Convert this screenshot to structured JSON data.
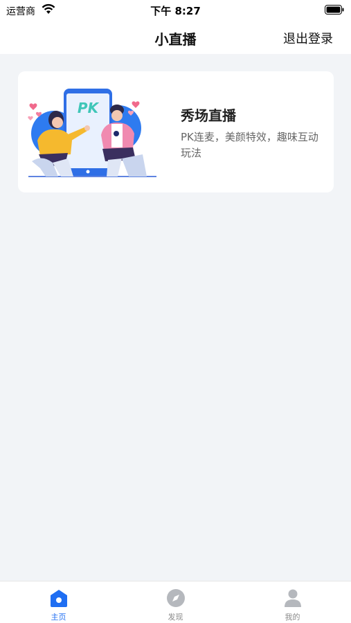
{
  "status_bar": {
    "carrier": "运营商",
    "time": "下午 8:27"
  },
  "nav": {
    "title": "小直播",
    "logout_label": "退出登录"
  },
  "card": {
    "title": "秀场直播",
    "description": "PK连麦，美颜特效，趣味互动玩法",
    "illustration_text": "PK"
  },
  "tabs": [
    {
      "label": "主页",
      "icon": "home-icon",
      "active": true
    },
    {
      "label": "发现",
      "icon": "compass-icon",
      "active": false
    },
    {
      "label": "我的",
      "icon": "profile-icon",
      "active": false
    }
  ],
  "colors": {
    "accent": "#1f6ef2",
    "inactive": "#b5b8bd",
    "background": "#f2f4f7"
  }
}
